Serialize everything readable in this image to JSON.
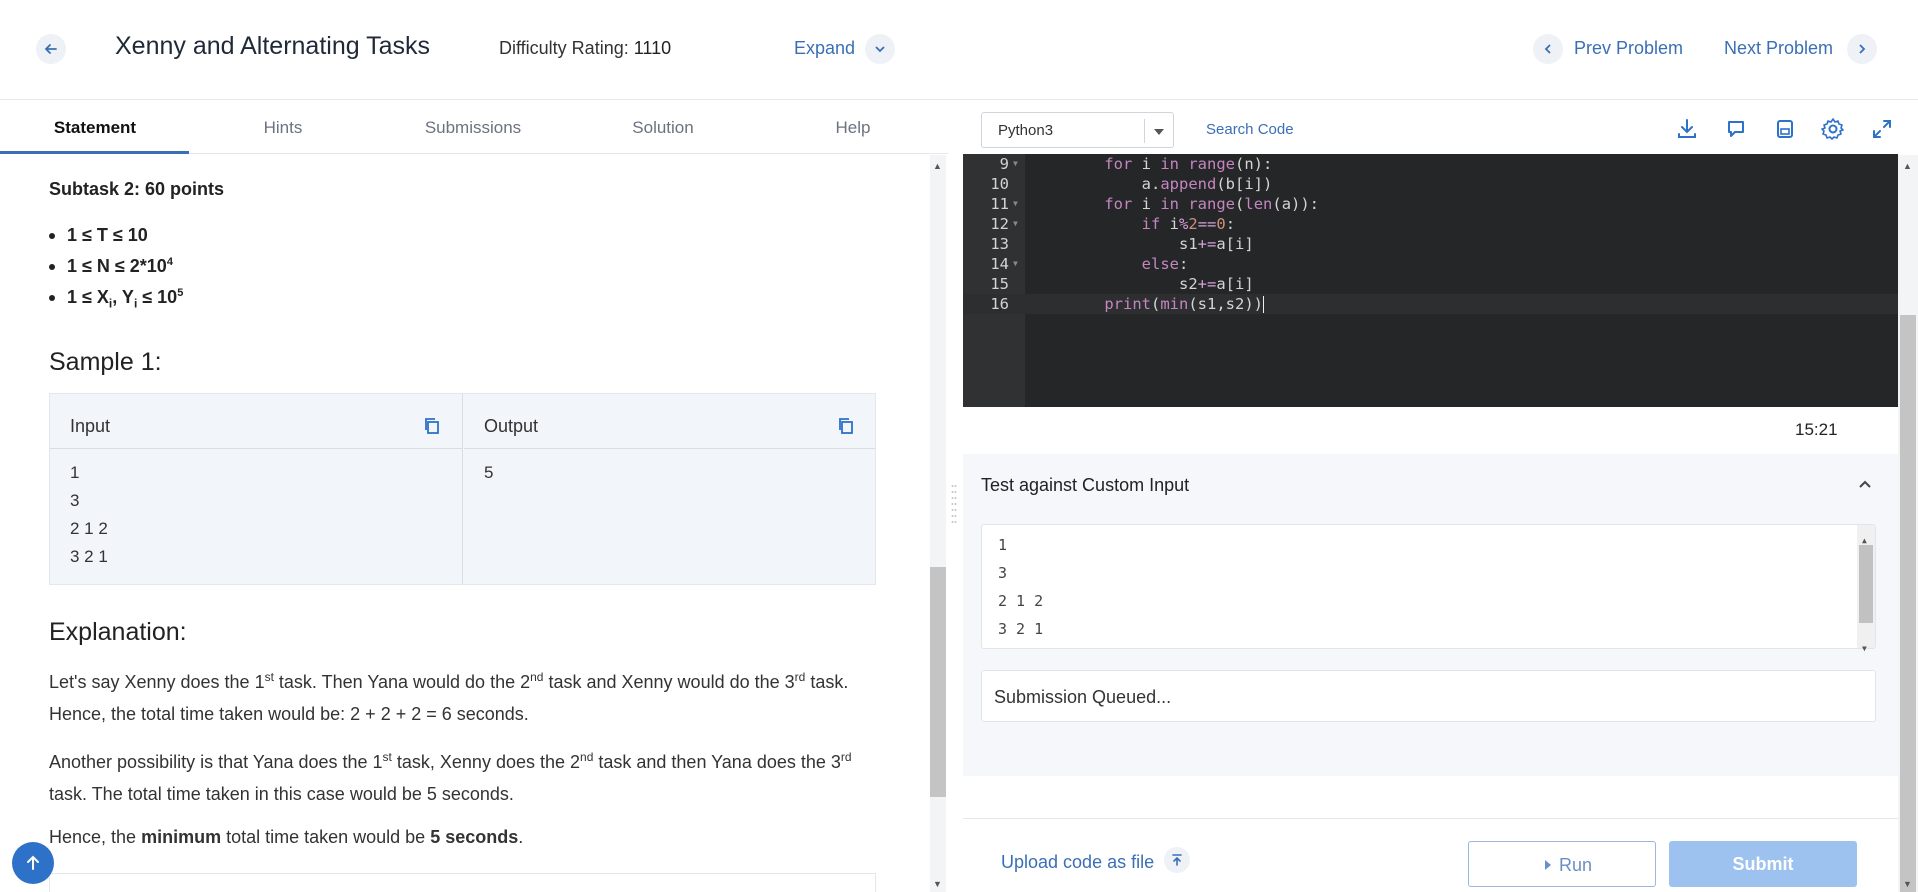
{
  "header": {
    "title": "Xenny and Alternating Tasks",
    "difficulty_label": "Difficulty Rating:",
    "difficulty_value": "1110",
    "expand_label": "Expand",
    "prev_label": "Prev Problem",
    "next_label": "Next Problem"
  },
  "tabs": [
    {
      "label": "Statement",
      "active": true
    },
    {
      "label": "Hints",
      "active": false
    },
    {
      "label": "Submissions",
      "active": false
    },
    {
      "label": "Solution",
      "active": false
    },
    {
      "label": "Help",
      "active": false
    }
  ],
  "statement": {
    "subtask_heading": "Subtask 2: 60 points",
    "sample_heading": "Sample 1:",
    "sample": {
      "input_label": "Input",
      "output_label": "Output",
      "input_lines": [
        "1",
        "3",
        "2 1 2",
        "3 2 1"
      ],
      "output_lines": [
        "5"
      ]
    },
    "explanation_heading": "Explanation:"
  },
  "editor": {
    "language": "Python3",
    "search_code_label": "Search Code",
    "timer": "15:21",
    "lines": [
      {
        "n": "9",
        "fold": true
      },
      {
        "n": "10",
        "fold": false
      },
      {
        "n": "11",
        "fold": true
      },
      {
        "n": "12",
        "fold": true
      },
      {
        "n": "13",
        "fold": false
      },
      {
        "n": "14",
        "fold": true
      },
      {
        "n": "15",
        "fold": false
      },
      {
        "n": "16",
        "fold": false
      }
    ]
  },
  "custom_input": {
    "heading": "Test against Custom Input",
    "lines": [
      "1",
      "3",
      "2 1 2",
      "3 2 1"
    ],
    "status": "Submission Queued..."
  },
  "actions": {
    "upload_label": "Upload code as file",
    "run_label": "Run",
    "submit_label": "Submit"
  },
  "colors": {
    "accent": "#3a6fb5",
    "submit_disabled": "#9ec2ef",
    "editor_bg": "#242628"
  }
}
